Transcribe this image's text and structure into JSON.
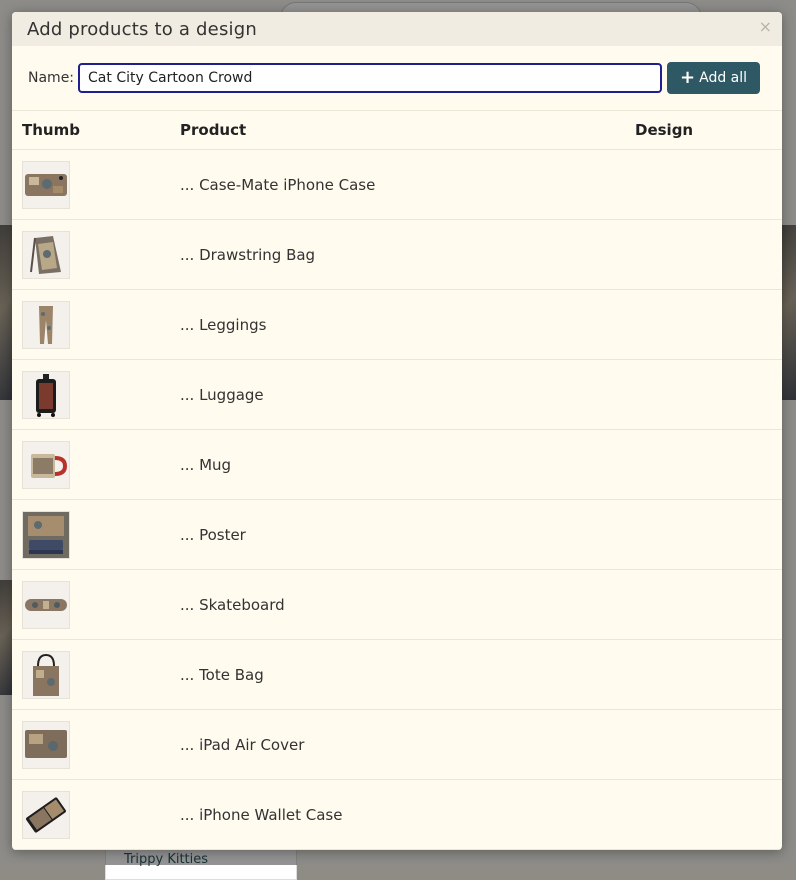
{
  "dialog": {
    "title": "Add products to a design",
    "close_symbol": "×",
    "name_label": "Name:",
    "name_value": "Cat City Cartoon Crowd",
    "add_all_label": "Add all",
    "add_all_icon": "plus-icon"
  },
  "table": {
    "columns": [
      "Thumb",
      "Product",
      "Design"
    ],
    "rows": [
      {
        "product": "... Case-Mate iPhone Case",
        "thumb_icon": "phone-case-thumbnail"
      },
      {
        "product": "... Drawstring Bag",
        "thumb_icon": "drawstring-bag-thumbnail"
      },
      {
        "product": "... Leggings",
        "thumb_icon": "leggings-thumbnail"
      },
      {
        "product": "... Luggage",
        "thumb_icon": "luggage-thumbnail"
      },
      {
        "product": "... Mug",
        "thumb_icon": "mug-thumbnail"
      },
      {
        "product": "... Poster",
        "thumb_icon": "poster-thumbnail"
      },
      {
        "product": "... Skateboard",
        "thumb_icon": "skateboard-thumbnail"
      },
      {
        "product": "... Tote Bag",
        "thumb_icon": "tote-bag-thumbnail"
      },
      {
        "product": "... iPad Air Cover",
        "thumb_icon": "ipad-cover-thumbnail"
      },
      {
        "product": "... iPhone Wallet Case",
        "thumb_icon": "wallet-case-thumbnail"
      }
    ]
  },
  "background": {
    "visible_text": "Trippy Kitties"
  },
  "colors": {
    "accent_button": "#2e5863",
    "input_focus_border": "#1f1f8f",
    "dialog_bg": "#fffbef"
  }
}
